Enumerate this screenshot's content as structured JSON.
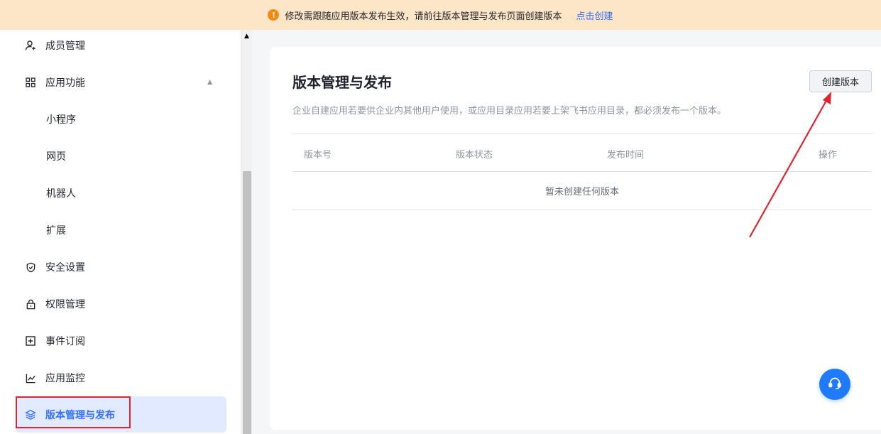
{
  "banner": {
    "icon": "warning-icon",
    "message": "修改需跟随应用版本发布生效，请前往版本管理与发布页面创建版本",
    "link": "点击创建",
    "color": "#fde6c7"
  },
  "sidebar": {
    "items": [
      {
        "label": "成员管理",
        "icon": "user-add-icon"
      },
      {
        "label": "应用功能",
        "icon": "grid-icon",
        "expanded": true
      },
      {
        "label": "小程序"
      },
      {
        "label": "网页"
      },
      {
        "label": "机器人"
      },
      {
        "label": "扩展"
      },
      {
        "label": "安全设置",
        "icon": "shield-icon"
      },
      {
        "label": "权限管理",
        "icon": "lock-icon"
      },
      {
        "label": "事件订阅",
        "icon": "plus-box-icon"
      },
      {
        "label": "应用监控",
        "icon": "line-chart-icon"
      },
      {
        "label": "版本管理与发布",
        "icon": "layers-icon",
        "active": true
      }
    ]
  },
  "main": {
    "title": "版本管理与发布",
    "create_button": "创建版本",
    "description": "企业自建应用若要供企业内其他用户使用，或应用目录应用若要上架飞书应用目录，都必须发布一个版本。",
    "table": {
      "columns": [
        "版本号",
        "版本状态",
        "发布时间",
        "操作"
      ],
      "empty_text": "暂未创建任何版本"
    }
  },
  "help_button": {
    "icon": "headset-icon",
    "color": "#1f7afe"
  },
  "colors": {
    "accent": "#3370ff",
    "annotation": "#e0242e"
  }
}
